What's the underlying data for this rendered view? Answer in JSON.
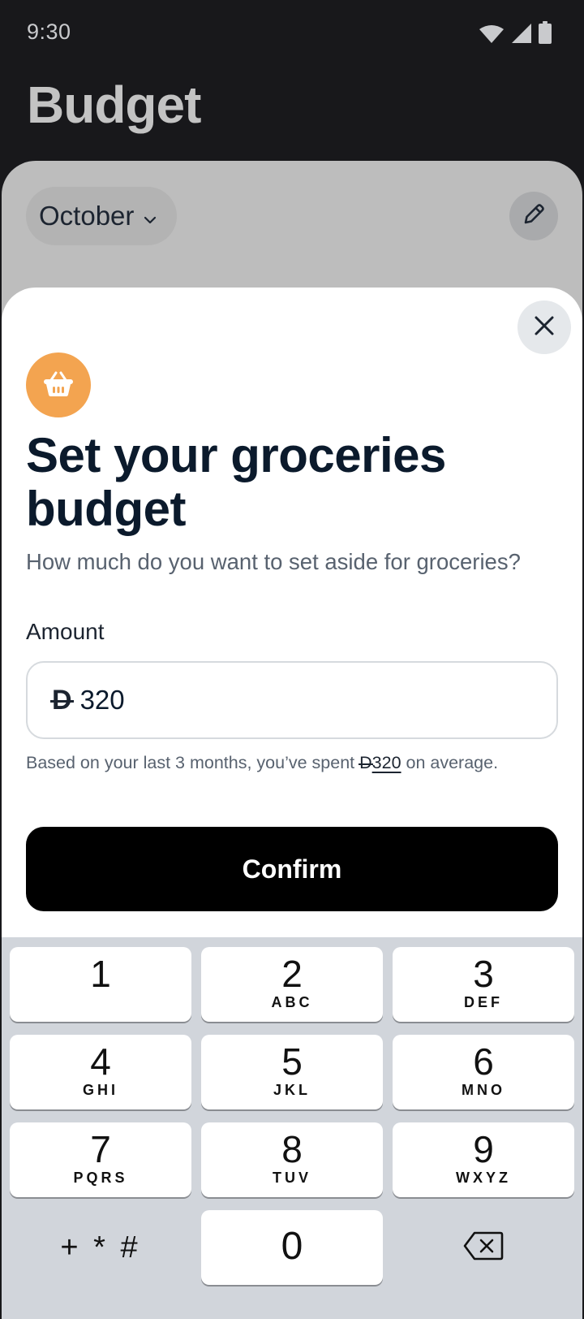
{
  "status_bar": {
    "time": "9:30"
  },
  "header": {
    "title": "Budget"
  },
  "background": {
    "month": "October"
  },
  "sheet": {
    "title": "Set your groceries budget",
    "subtitle": "How much do you want to set aside for groceries?",
    "amount_label": "Amount",
    "currency_symbol": "D",
    "amount_value": "320",
    "hint_prefix": "Based on your last 3 months, you’ve spent ",
    "hint_amount": "320",
    "hint_suffix": " on average.",
    "confirm_label": "Confirm"
  },
  "keypad": {
    "keys": [
      {
        "num": "1",
        "letters": ""
      },
      {
        "num": "2",
        "letters": "ABC"
      },
      {
        "num": "3",
        "letters": "DEF"
      },
      {
        "num": "4",
        "letters": "GHI"
      },
      {
        "num": "5",
        "letters": "JKL"
      },
      {
        "num": "6",
        "letters": "MNO"
      },
      {
        "num": "7",
        "letters": "PQRS"
      },
      {
        "num": "8",
        "letters": "TUV"
      },
      {
        "num": "9",
        "letters": "WXYZ"
      }
    ],
    "symbols": "+ * #",
    "zero": "0"
  },
  "colors": {
    "accent_badge": "#f3a450",
    "confirm_bg": "#000000",
    "title_text": "#0b1a2c"
  },
  "icons": {
    "category": "basket-icon",
    "close": "close-icon",
    "edit": "pencil-icon",
    "backspace": "backspace-icon"
  }
}
